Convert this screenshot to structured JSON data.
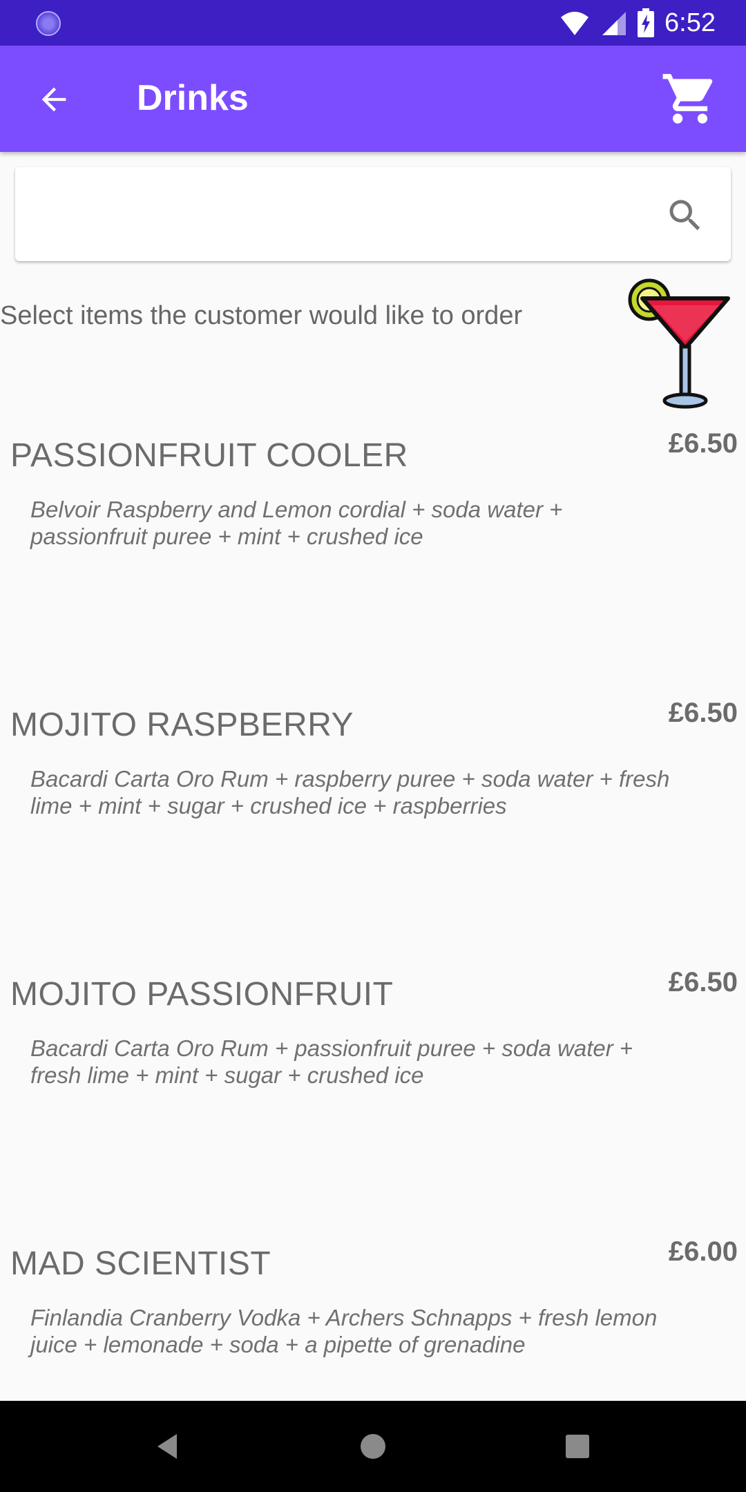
{
  "status": {
    "time": "6:52"
  },
  "app_bar": {
    "title": "Drinks"
  },
  "search": {
    "placeholder": ""
  },
  "instruction": "Select items the customer would like to order",
  "items": [
    {
      "name": "PASSIONFRUIT COOLER",
      "price": "£6.50",
      "description": "Belvoir Raspberry and Lemon cordial + soda water + passionfruit puree + mint + crushed ice"
    },
    {
      "name": "MOJITO RASPBERRY",
      "price": "£6.50",
      "description": "Bacardi Carta Oro Rum + raspberry puree + soda water + fresh lime + mint + sugar + crushed ice + raspberries"
    },
    {
      "name": "MOJITO PASSIONFRUIT",
      "price": "£6.50",
      "description": "Bacardi Carta Oro Rum + passionfruit puree + soda water + fresh lime + mint + sugar + crushed ice"
    },
    {
      "name": "MAD SCIENTIST",
      "price": "£6.00",
      "description": "Finlandia Cranberry Vodka + Archers Schnapps + fresh lemon juice + lemonade + soda + a pipette of grenadine"
    }
  ],
  "icons": {
    "back": "arrow-back-icon",
    "cart": "shopping-cart-icon",
    "search": "search-icon",
    "cocktail": "cocktail-icon",
    "wifi": "wifi-icon",
    "signal": "signal-icon",
    "battery": "battery-charging-icon",
    "nav_back": "nav-back-icon",
    "nav_home": "nav-home-icon",
    "nav_recents": "nav-recents-icon"
  },
  "colors": {
    "status_bar": "#3d1fc4",
    "app_bar": "#7c4dff",
    "background": "#fafafa",
    "text": "#6b6b6b",
    "cocktail": "#e8163c"
  }
}
